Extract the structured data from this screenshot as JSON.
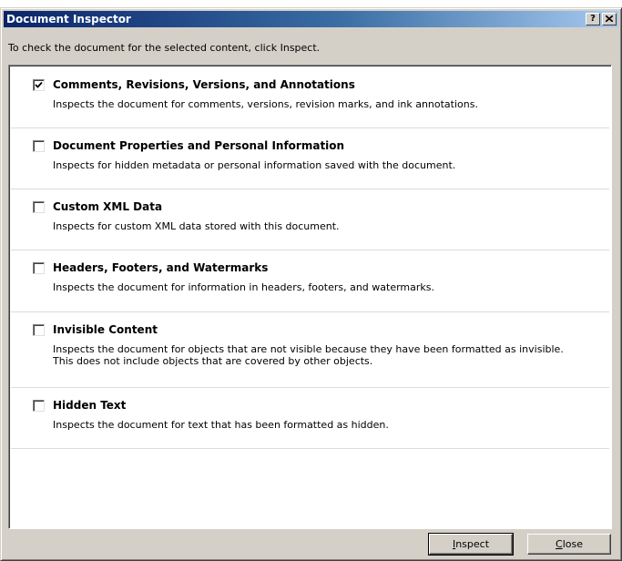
{
  "dialog": {
    "title": "Document Inspector",
    "help_glyph": "?",
    "instruction": "To check the document for the selected content, click Inspect."
  },
  "items": [
    {
      "name": "Comments, Revisions, Versions, and Annotations",
      "desc": "Inspects the document for comments, versions, revision marks, and ink annotations.",
      "checked": true
    },
    {
      "name": "Document Properties and Personal Information",
      "desc": "Inspects for hidden metadata or personal information saved with the document.",
      "checked": false
    },
    {
      "name": "Custom XML Data",
      "desc": "Inspects for custom XML data stored with this document.",
      "checked": false
    },
    {
      "name": "Headers, Footers, and Watermarks",
      "desc": "Inspects the document for information in headers, footers, and watermarks.",
      "checked": false
    },
    {
      "name": "Invisible Content",
      "desc": "Inspects the document for objects that are not visible because they have been formatted as invisible. This does not include objects that are covered by other objects.",
      "checked": false
    },
    {
      "name": "Hidden Text",
      "desc": "Inspects the document for text that has been formatted as hidden.",
      "checked": false
    }
  ],
  "buttons": {
    "inspect_key": "I",
    "inspect_rest": "nspect",
    "close_key": "C",
    "close_rest": "lose"
  },
  "icons": {
    "help": "help-icon",
    "close": "close-icon",
    "check": "checkmark-icon"
  },
  "colors": {
    "titlebar_start": "#0a246a",
    "titlebar_end": "#a6caf0",
    "face": "#d4d0c8"
  }
}
